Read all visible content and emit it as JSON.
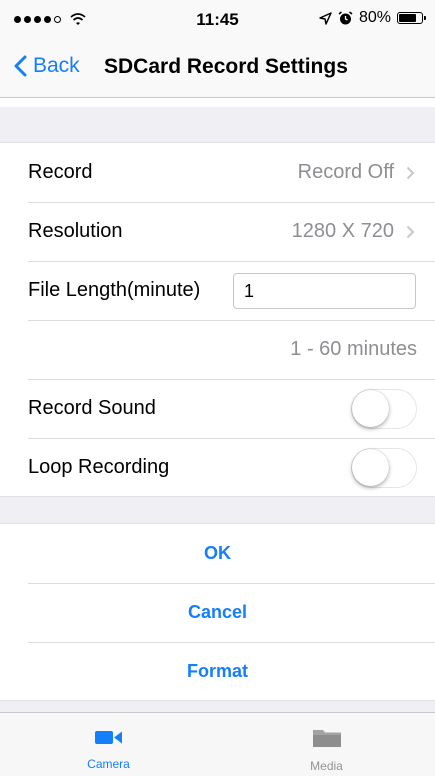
{
  "status_bar": {
    "time": "11:45",
    "battery": "80%",
    "battery_level": 0.8,
    "icons": [
      "signal-dots-icon",
      "wifi-icon",
      "location-icon",
      "alarm-icon",
      "battery-icon"
    ]
  },
  "nav": {
    "back_label": "Back",
    "title": "SDCard Record Settings"
  },
  "settings": {
    "record_label": "Record",
    "record_value": "Record Off",
    "resolution_label": "Resolution",
    "resolution_value": "1280 X 720",
    "file_length_label": "File Length(minute)",
    "file_length_value": "1",
    "file_length_hint": "1 - 60 minutes",
    "record_sound_label": "Record Sound",
    "record_sound_on": false,
    "loop_recording_label": "Loop Recording",
    "loop_recording_on": false
  },
  "actions": {
    "ok": "OK",
    "cancel": "Cancel",
    "format": "Format"
  },
  "tabs": [
    {
      "label": "Camera",
      "icon": "video-camera-icon",
      "selected": true
    },
    {
      "label": "Media",
      "icon": "folder-icon",
      "selected": false
    }
  ],
  "colors": {
    "accent": "#157efb",
    "inactive_tab": "#929292",
    "background": "#efeff4"
  }
}
